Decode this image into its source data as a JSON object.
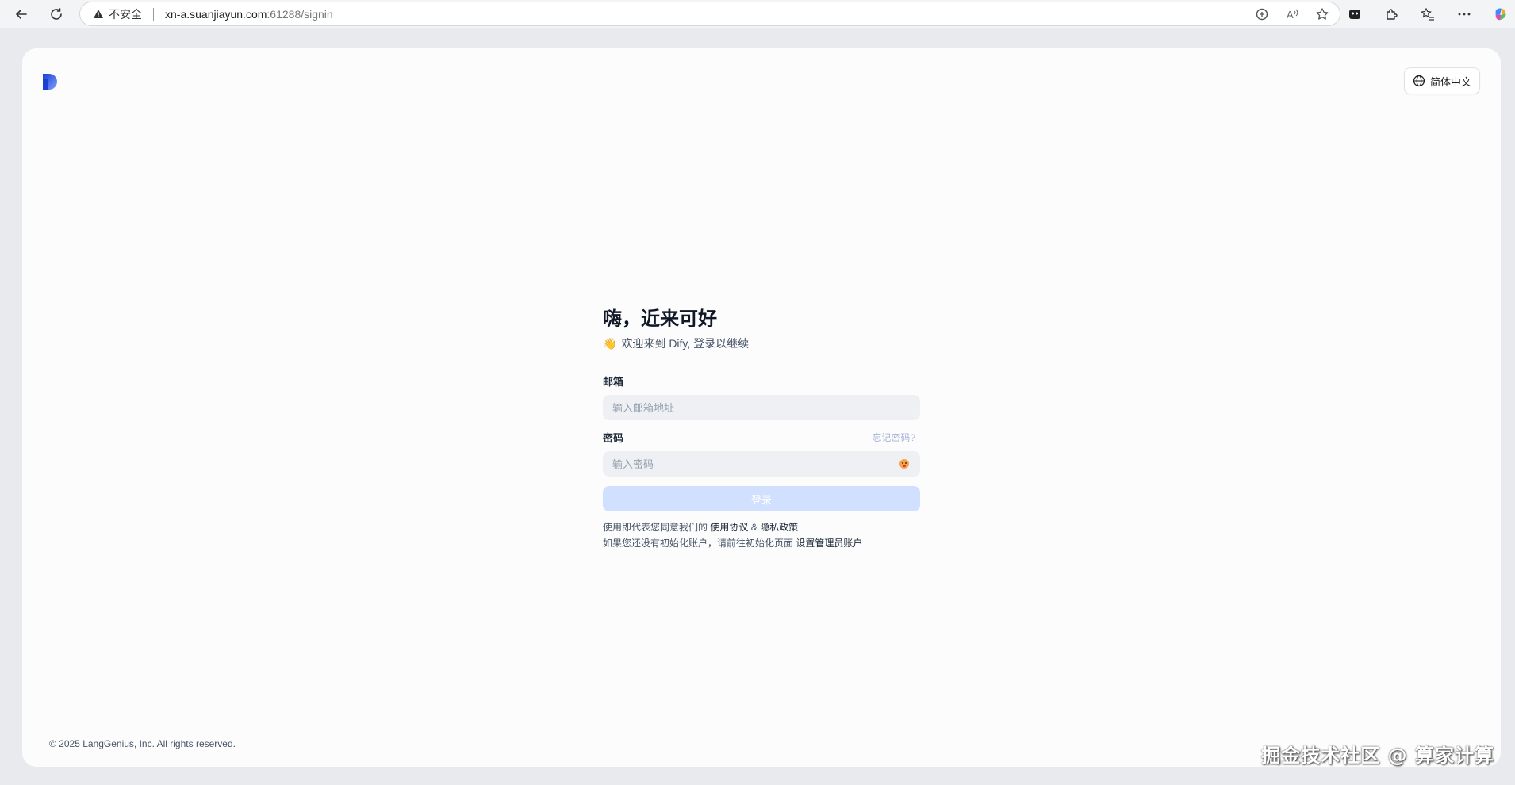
{
  "browser": {
    "security_label": "不安全",
    "url_host": "xn-a.suanjiayun.com",
    "url_rest": ":61288/signin"
  },
  "header": {
    "language_label": "简体中文"
  },
  "signin": {
    "title": "嗨，近来可好",
    "wave_emoji": "👋",
    "subtitle": "欢迎来到 Dify, 登录以继续",
    "email_label": "邮箱",
    "email_placeholder": "输入邮箱地址",
    "password_label": "密码",
    "forgot_password": "忘记密码?",
    "password_placeholder": "输入密码",
    "login_button": "登录",
    "terms_prefix": "使用即代表您同意我们的",
    "terms_link": "使用协议",
    "terms_and": "&",
    "privacy_link": "隐私政策",
    "init_prefix": "如果您还没有初始化账户，请前往初始化页面",
    "init_link": "设置管理员账户"
  },
  "footer": {
    "copyright": "© 2025 LangGenius, Inc. All rights reserved."
  },
  "watermark": "掘金技术社区 @ 算家计算",
  "colors": {
    "accent": "#155eef",
    "login_button_disabled": "#d1e0ff",
    "input_bg": "#eef0f3"
  }
}
